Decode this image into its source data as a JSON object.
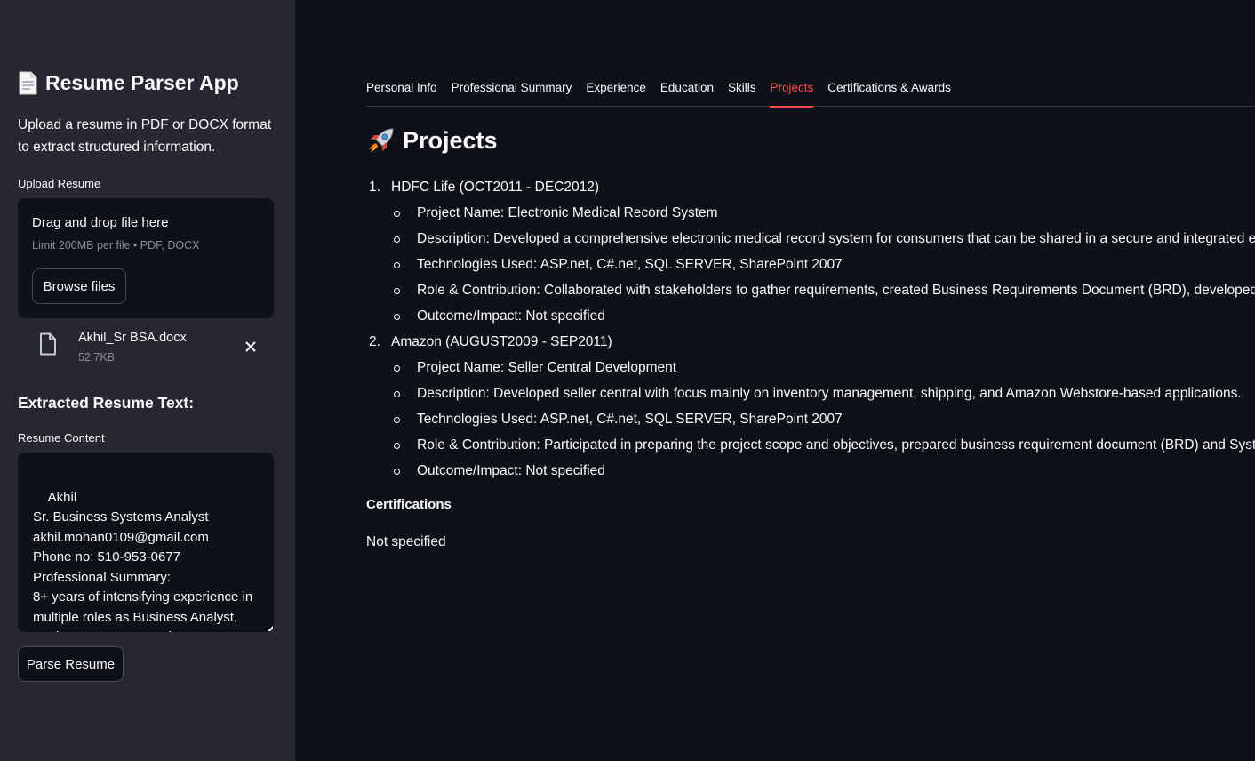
{
  "sidebar": {
    "app_title": "Resume Parser App",
    "app_description": "Upload a resume in PDF or DOCX format to extract structured information.",
    "upload_label": "Upload Resume",
    "dropzone": {
      "title": "Drag and drop file here",
      "limit_text": "Limit 200MB per file • PDF, DOCX",
      "browse_label": "Browse files"
    },
    "uploaded_file": {
      "name": "Akhil_Sr BSA.docx",
      "size": "52.7KB"
    },
    "extracted_heading": "Extracted Resume Text:",
    "content_label": "Resume Content",
    "resume_text": "Akhil\nSr. Business Systems Analyst\nakhil.mohan0109@gmail.com\nPhone no: 510-953-0677\nProfessional Summary:\n8+ years of intensifying experience in multiple roles as Business Analyst, Business Systems Analyst, Scrum",
    "parse_button_label": "Parse Resume"
  },
  "tabs": [
    {
      "label": "Personal Info",
      "active": false
    },
    {
      "label": "Professional Summary",
      "active": false
    },
    {
      "label": "Experience",
      "active": false
    },
    {
      "label": "Education",
      "active": false
    },
    {
      "label": "Skills",
      "active": false
    },
    {
      "label": "Projects",
      "active": true
    },
    {
      "label": "Certifications & Awards",
      "active": false
    }
  ],
  "main": {
    "section_title": "Projects",
    "projects": [
      {
        "number": "1.",
        "title": "HDFC Life (OCT2011 - DEC2012)",
        "details": [
          "Project Name: Electronic Medical Record System",
          "Description: Developed a comprehensive electronic medical record system for consumers that can be shared in a secure and integrated environment.",
          "Technologies Used: ASP.net, C#.net, SQL SERVER, SharePoint 2007",
          "Role & Contribution: Collaborated with stakeholders to gather requirements, created Business Requirements Document (BRD), developed use cases.",
          "Outcome/Impact: Not specified"
        ]
      },
      {
        "number": "2.",
        "title": "Amazon (AUGUST2009 - SEP2011)",
        "details": [
          "Project Name: Seller Central Development",
          "Description: Developed seller central with focus mainly on inventory management, shipping, and Amazon Webstore-based applications.",
          "Technologies Used: ASP.net, C#.net, SQL SERVER, SharePoint 2007",
          "Role & Contribution: Participated in preparing the project scope and objectives, prepared business requirement document (BRD) and System Requirements.",
          "Outcome/Impact: Not specified"
        ]
      }
    ],
    "certifications_heading": "Certifications",
    "certifications_value": "Not specified"
  },
  "colors": {
    "sidebar_bg": "#262730",
    "main_bg": "#0e1117",
    "accent": "#ff4b4b",
    "text": "#fafafa",
    "muted": "#8b8d96"
  },
  "icons": {
    "title_icon": "document-icon",
    "file_icon": "file-icon",
    "remove_icon": "close-icon",
    "section_icon": "rocket-icon"
  }
}
